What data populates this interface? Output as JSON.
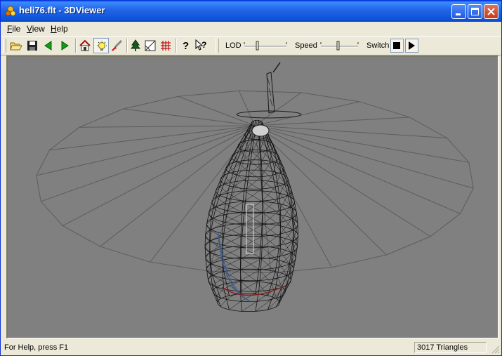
{
  "window": {
    "title": "heli76.flt - 3DViewer",
    "icon": "3dviewer-app-icon",
    "controls": [
      "minimize-icon",
      "maximize-icon",
      "close-icon"
    ]
  },
  "menu": {
    "items": [
      {
        "label": "File",
        "mnemonic": "F",
        "rest": "ile"
      },
      {
        "label": "View",
        "mnemonic": "V",
        "rest": "iew"
      },
      {
        "label": "Help",
        "mnemonic": "H",
        "rest": "elp"
      }
    ]
  },
  "toolbar": {
    "buttons": [
      "open-folder-icon",
      "save-disk-icon",
      "back-arrow-icon",
      "forward-arrow-icon",
      "home-icon",
      "lightbulb-icon",
      "paint-icon",
      "tree-icon",
      "texture-icon",
      "grid-icon",
      "help-icon",
      "context-help-icon"
    ],
    "pressed": [
      "lightbulb-icon"
    ],
    "lod_label": "LOD",
    "speed_label": "Speed",
    "switch_label": "Switch",
    "lod_level": 0.35,
    "speed_level": 0.5,
    "stop_icon": "stop-square-icon",
    "play_icon": "play-triangle-icon"
  },
  "viewport": {
    "background": "#808080",
    "model": "helicopter wireframe"
  },
  "status": {
    "message": "For Help, press F1",
    "triangles": "3017 Triangles"
  }
}
